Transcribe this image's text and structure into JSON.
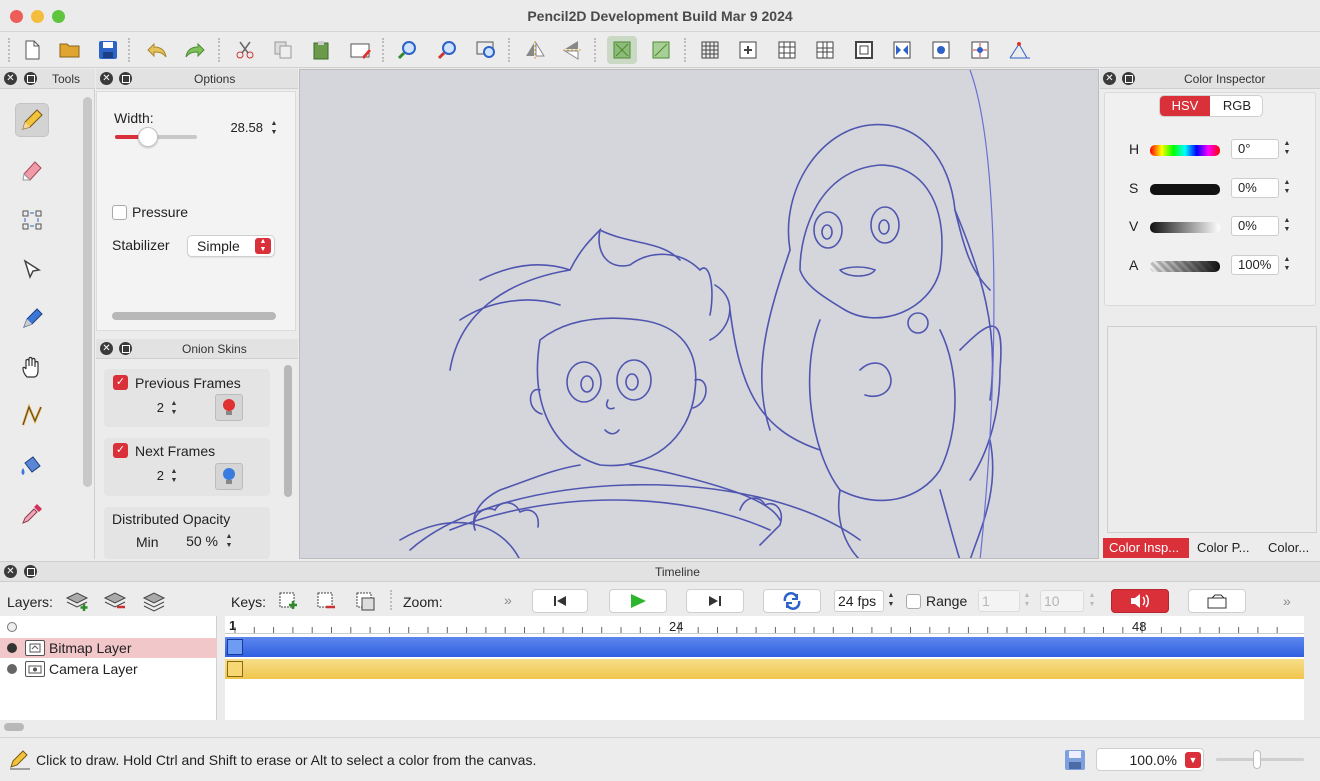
{
  "window": {
    "title": "Pencil2D Development Build Mar  9 2024"
  },
  "toolbar": {
    "icons": [
      "new-file",
      "open-folder",
      "save",
      "undo",
      "redo",
      "cut",
      "copy",
      "paste",
      "clear-frame",
      "zoom-in",
      "zoom-out",
      "zoom-fit",
      "flip-horizontal",
      "flip-vertical",
      "onion-previous",
      "onion-next",
      "grid",
      "center-marker",
      "thirds-grid",
      "golden-ratio",
      "safe-area",
      "horizontal-mirror",
      "vertical-mirror",
      "overlay",
      "perspective"
    ]
  },
  "tools_panel": {
    "title": "Tools"
  },
  "options_panel": {
    "title": "Options",
    "width_label": "Width:",
    "width_value": "28.58",
    "width_fraction": 0.4,
    "pressure_label": "Pressure",
    "stabilizer_label": "Stabilizer",
    "stabilizer_value": "Simple"
  },
  "onion_panel": {
    "title": "Onion Skins",
    "previous_label": "Previous Frames",
    "previous_value": "2",
    "next_label": "Next Frames",
    "next_value": "2",
    "opacity_label": "Distributed Opacity",
    "min_label": "Min",
    "min_value": "50 %"
  },
  "color_panel": {
    "title": "Color Inspector",
    "tabs": [
      "HSV",
      "RGB"
    ],
    "rows": [
      {
        "label": "H",
        "value": "0°"
      },
      {
        "label": "S",
        "value": "0%"
      },
      {
        "label": "V",
        "value": "0%"
      },
      {
        "label": "A",
        "value": "100%"
      }
    ],
    "bottom_tabs": [
      "Color Insp...",
      "Color P...",
      "Color..."
    ]
  },
  "timeline": {
    "title": "Timeline",
    "layers_label": "Layers:",
    "keys_label": "Keys:",
    "zoom_label": "Zoom:",
    "fps_value": "24 fps",
    "range_label": "Range",
    "range_start": "1",
    "range_end": "10",
    "ruler": {
      "start": "1",
      "mark24": "24",
      "mark48": "48"
    },
    "layers": [
      {
        "name": "Bitmap Layer",
        "color": "#3b6fe0"
      },
      {
        "name": "Camera Layer",
        "color": "#f2cc5c"
      }
    ]
  },
  "status": {
    "message": "Click to draw. Hold Ctrl and Shift to erase or Alt to select a color from the canvas.",
    "zoom": "100.0%"
  },
  "colors": {
    "accent": "#d9303a",
    "selection": "#f2c7c9",
    "canvas": "#d4d6dc"
  }
}
